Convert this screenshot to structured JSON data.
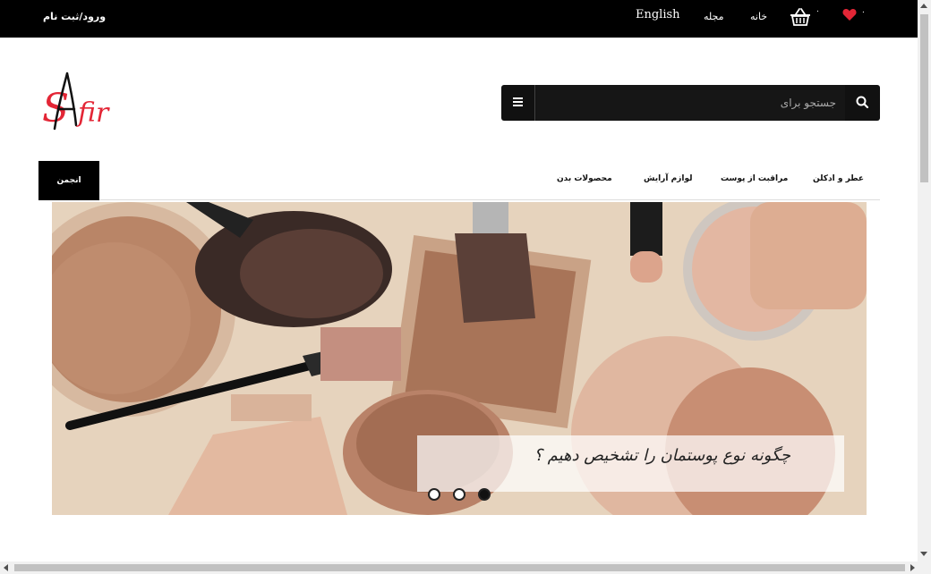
{
  "topbar": {
    "login_label": "ورود/ثبت نام",
    "language_label": "English",
    "magazine_label": "مجله",
    "home_label": "خانه",
    "basket_count": "۰",
    "favorites_count": "۰",
    "accent_heart": "#e32636"
  },
  "logo": {
    "brand": "SAfir",
    "brand_color": "#e32636"
  },
  "search": {
    "placeholder": "جستجو برای"
  },
  "nav": {
    "forum_label": "انجمن",
    "items": [
      {
        "label": "عطر و ادکلن"
      },
      {
        "label": "مراقبت از پوست"
      },
      {
        "label": "لوازم آرایش"
      },
      {
        "label": "محصولات بدن"
      }
    ]
  },
  "hero": {
    "caption": "چگونه نوع پوستمان را تشخیص دهیم ؟",
    "slides_count": 3,
    "active_slide": 3
  }
}
